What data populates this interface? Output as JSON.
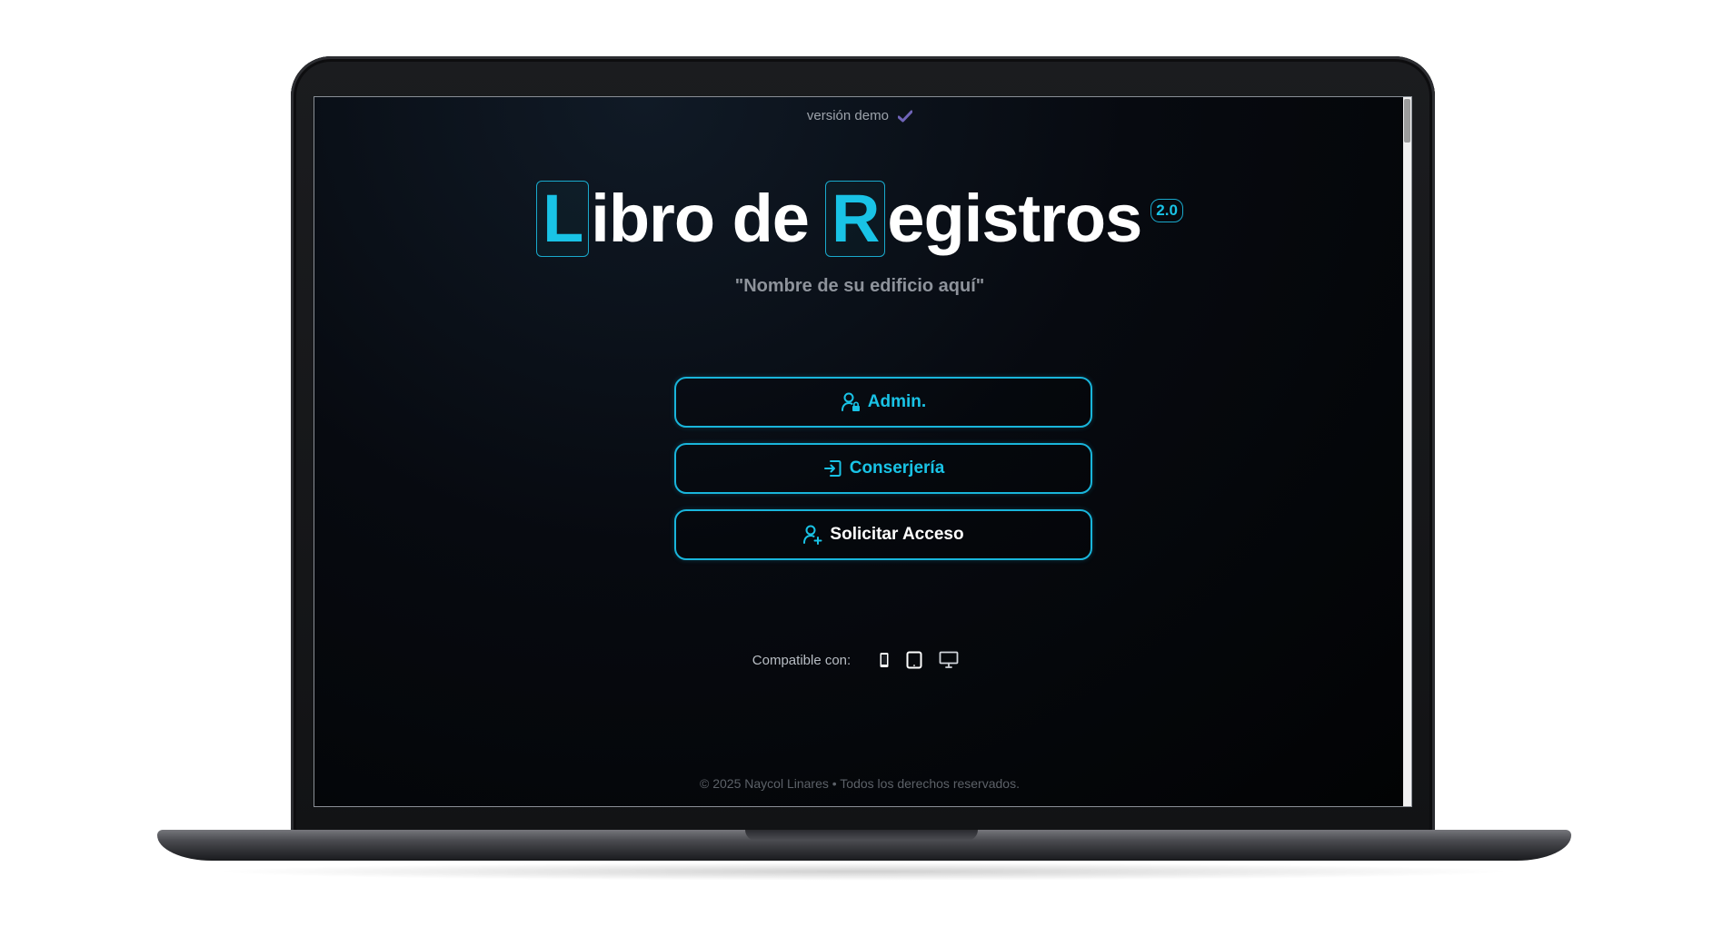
{
  "demo_label": "versión demo",
  "title": {
    "letter_l": "L",
    "rest_1": "ibro de",
    "letter_r": "R",
    "rest_2": "egistros",
    "version": "2.0"
  },
  "subtitle": "\"Nombre de su edificio aquí\"",
  "buttons": {
    "admin": "Admin.",
    "conserjeria": "Conserjería",
    "acceso": "Solicitar Acceso"
  },
  "compat_label": "Compatible con:",
  "compat_devices": [
    "phone-icon",
    "tablet-icon",
    "desktop-icon"
  ],
  "footer": "© 2025 Naycol Linares • Todos los derechos reservados.",
  "colors": {
    "accent": "#19c3e6",
    "background": "#05070b",
    "text": "#ffffff"
  }
}
